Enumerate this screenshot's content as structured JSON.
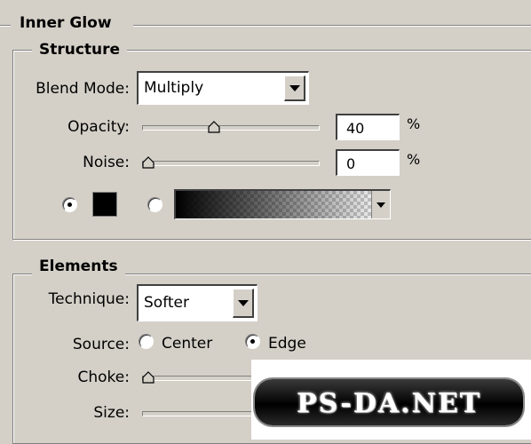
{
  "panel": {
    "title": "Inner Glow",
    "structure": {
      "title": "Structure",
      "blend_mode_label": "Blend Mode:",
      "blend_mode_value": "Multiply",
      "opacity_label": "Opacity:",
      "opacity_value": "40",
      "opacity_fraction": 0.4,
      "noise_label": "Noise:",
      "noise_value": "0",
      "noise_fraction": 0.0,
      "percent_sign": "%",
      "color_mode": "solid",
      "solid_color": "#000000"
    },
    "elements": {
      "title": "Elements",
      "technique_label": "Technique:",
      "technique_value": "Softer",
      "source_label": "Source:",
      "source_center_label": "Center",
      "source_edge_label": "Edge",
      "source_selected": "edge",
      "choke_label": "Choke:",
      "choke_fraction": 0.0,
      "size_label": "Size:"
    }
  },
  "watermark": {
    "text": "PS-DA.NET"
  },
  "colors": {
    "background": "#d4d0c8",
    "shadow": "#808080",
    "highlight": "#ffffff"
  }
}
